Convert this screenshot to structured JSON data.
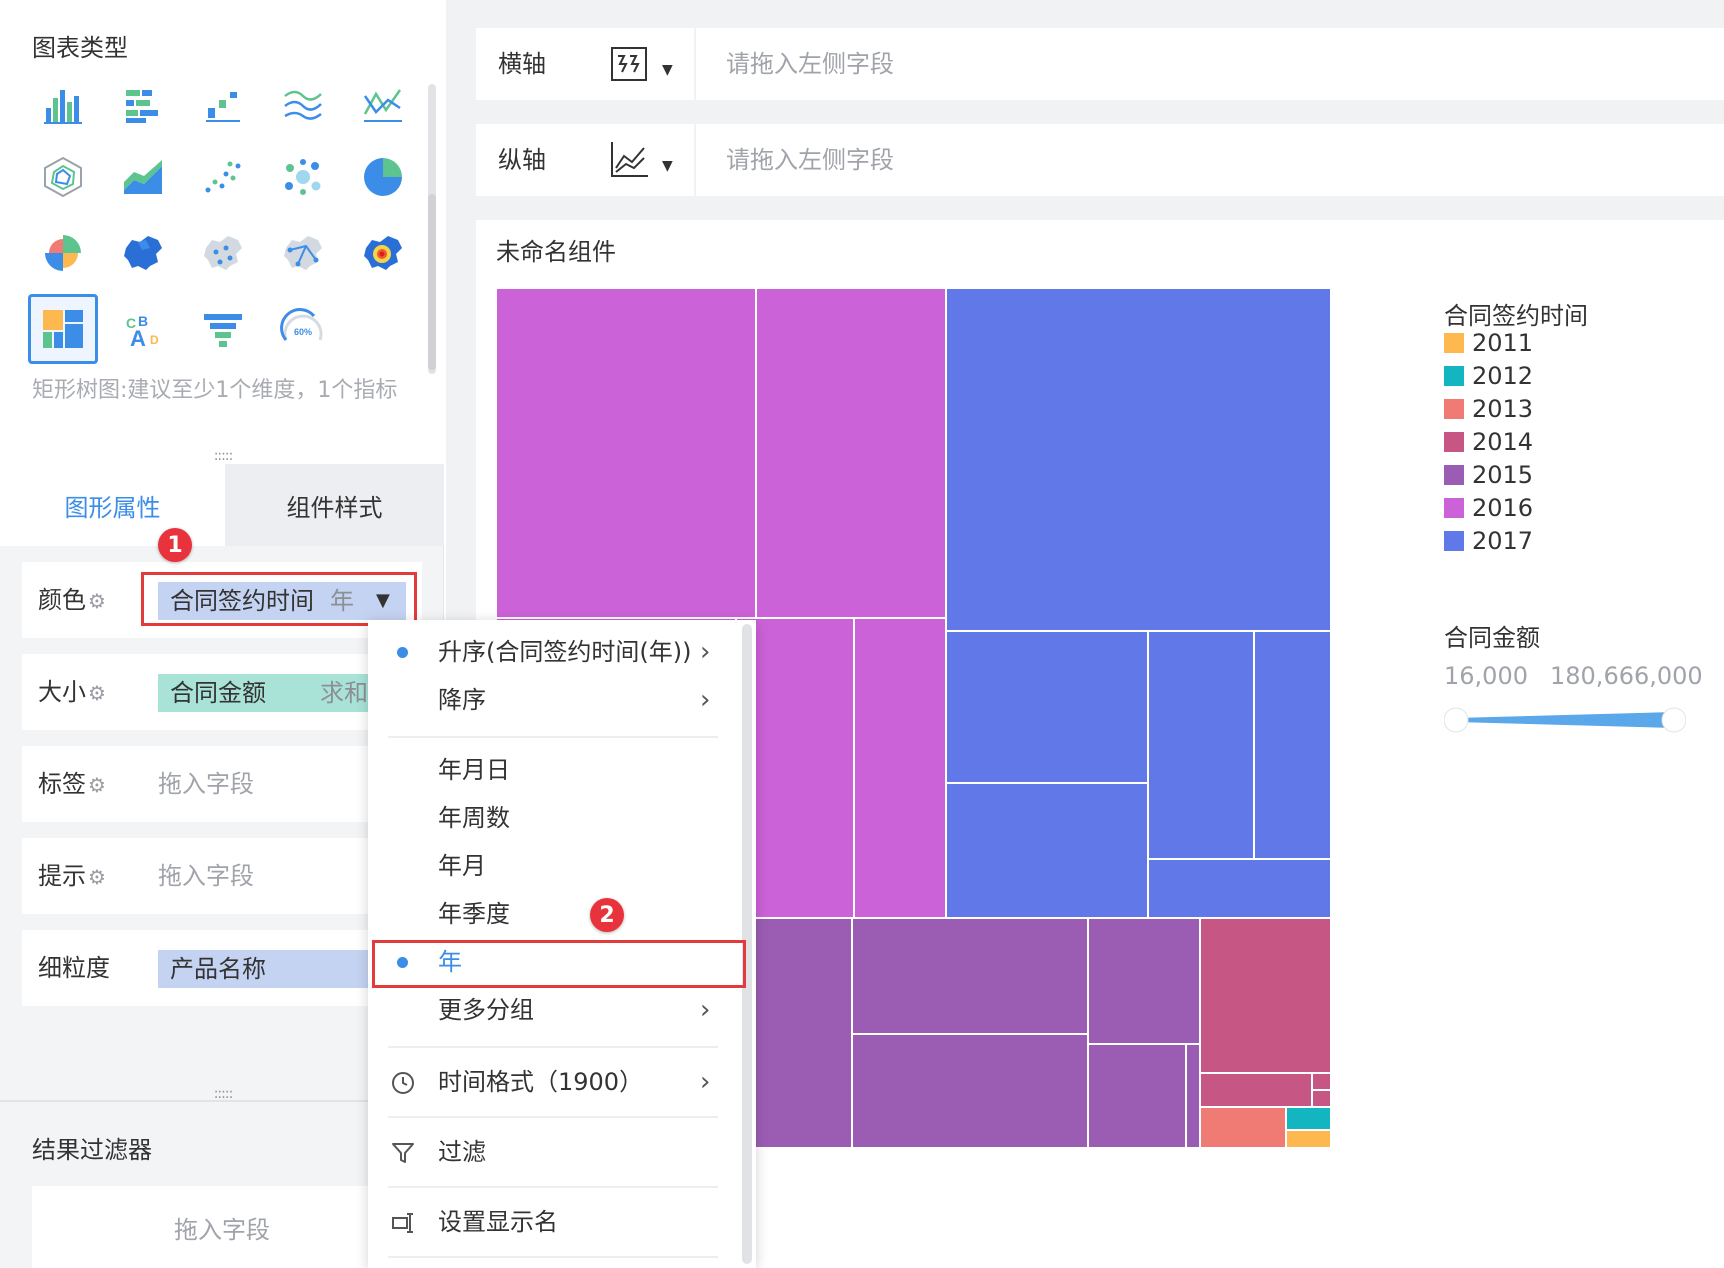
{
  "chart_type_panel": {
    "title": "图表类型",
    "hint": "矩形树图:建议至少1个维度，1个指标",
    "icons": [
      "grouped-bar-chart-icon",
      "stacked-bar-chart-icon",
      "range-bar-chart-icon",
      "multi-line-chart-icon",
      "line-chart-icon",
      "radar-chart-icon",
      "area-chart-icon",
      "scatter-chart-icon",
      "bubble-chart-icon",
      "pie-chart-icon",
      "rose-chart-icon",
      "region-map-icon",
      "point-map-icon",
      "flow-map-icon",
      "heat-map-icon",
      "treemap-chart-icon",
      "word-cloud-icon",
      "funnel-chart-icon",
      "gauge-chart-icon"
    ],
    "selected_icon": "treemap-chart-icon",
    "gauge_text": "60%"
  },
  "property_tabs": {
    "graph": "图形属性",
    "style": "组件样式"
  },
  "properties": {
    "color": {
      "label": "颜色",
      "field": "合同签约时间",
      "sub": "年"
    },
    "size": {
      "label": "大小",
      "field": "合同金额",
      "sub": "求和"
    },
    "label": {
      "label": "标签",
      "placeholder": "拖入字段"
    },
    "tooltip": {
      "label": "提示",
      "placeholder": "拖入字段"
    },
    "granularity": {
      "label": "细粒度",
      "field": "产品名称"
    }
  },
  "result_filter": {
    "title": "结果过滤器",
    "placeholder": "拖入字段"
  },
  "badges": {
    "first": "1",
    "second": "2"
  },
  "axes": {
    "x": {
      "label": "横轴",
      "placeholder": "请拖入左侧字段"
    },
    "y": {
      "label": "纵轴",
      "placeholder": "请拖入左侧字段"
    }
  },
  "component": {
    "title": "未命名组件"
  },
  "legend": {
    "color_title": "合同签约时间",
    "items": [
      {
        "name": "2011",
        "color": "#fdb94f"
      },
      {
        "name": "2012",
        "color": "#13b5c1"
      },
      {
        "name": "2013",
        "color": "#f07b74"
      },
      {
        "name": "2014",
        "color": "#c65684"
      },
      {
        "name": "2015",
        "color": "#9b5db4"
      },
      {
        "name": "2016",
        "color": "#cc62d8"
      },
      {
        "name": "2017",
        "color": "#6078e8"
      }
    ],
    "size_title": "合同金额",
    "size_min": "16,000",
    "size_max": "180,666,000",
    "slider_color": "#5aa7ea"
  },
  "menu": {
    "sort_asc": "升序(合同签约时间(年))",
    "sort_desc": "降序",
    "ymd": "年月日",
    "year_week": "年周数",
    "year_month": "年月",
    "year_quarter": "年季度",
    "year": "年",
    "more_groups": "更多分组",
    "time_format": "时间格式（1900）",
    "filter": "过滤",
    "display_name": "设置显示名"
  },
  "colors": {
    "accent": "#3b8de8",
    "highlight_box": "#e23b3b",
    "badge": "#e8323c"
  }
}
